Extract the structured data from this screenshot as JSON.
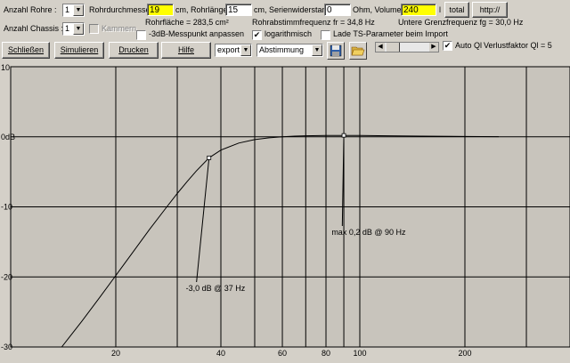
{
  "controls": {
    "anzahl_rohre_label": "Anzahl Rohre :",
    "anzahl_rohre_value": "1",
    "rohrdurchmesser_label": "Rohrdurchmesser",
    "rohrdurchmesser_value": "19",
    "rohrlaenge_label": "cm, Rohrlänge",
    "rohrlaenge_value": "15",
    "serienwiderstand_label": "cm, Serienwiderstand",
    "serienwiderstand_value": "0",
    "volumen_label": "Ohm, Volumen",
    "volumen_value": "240",
    "volumen_unit": "l",
    "total_button": "total",
    "http_button": "http://",
    "anzahl_chassis_label": "Anzahl Chassis :",
    "anzahl_chassis_value": "1",
    "kammern_label": "Kammern",
    "rohrflaeche_text": "Rohrfläche = 283,5 cm²",
    "rohrabstimm_text": "Rohrabstimmfrequenz fr = 34,8 Hz",
    "grenzfrequenz_text": "Untere Grenzfrequenz fg = 30,0 Hz",
    "messpunkt_label": "-3dB-Messpunkt anpassen",
    "logarithmisch_label": "logarithmisch",
    "ts_parameter_label": "Lade TS-Parameter beim Import",
    "schliessen_button": "Schließen",
    "simulieren_button": "Simulieren",
    "drucken_button": "Drucken",
    "hilfe_button": "Hilfe",
    "export_value": "export",
    "abstimmung_value": "Abstimmung",
    "auto_ql_label": "Auto Ql",
    "verlustfaktor_text": "Verlustfaktor Ql = 5"
  },
  "chart_data": {
    "type": "line",
    "x_scale": "log",
    "xlim": [
      10,
      400
    ],
    "ylim": [
      -30,
      10
    ],
    "x_ticks": [
      20,
      40,
      60,
      80,
      100,
      200
    ],
    "y_ticks": [
      10,
      0,
      -10,
      -20,
      -30
    ],
    "x_tick_labels": [
      "20",
      "40",
      "60",
      "80",
      "100",
      "200"
    ],
    "y_tick_labels": [
      "10",
      "0dB",
      "-10",
      "-20",
      "-30"
    ],
    "x_gridlines": [
      20,
      30,
      40,
      50,
      60,
      70,
      80,
      90,
      100,
      200,
      300
    ],
    "grid": true,
    "series": [
      {
        "x": [
          14,
          16,
          18,
          20,
          22,
          25,
          28,
          30,
          32,
          34,
          37,
          40,
          45,
          50,
          55,
          60,
          65,
          70,
          80,
          90,
          100,
          120,
          150,
          200,
          250
        ],
        "y": [
          -30,
          -26.3,
          -22.9,
          -19.8,
          -17.0,
          -13.2,
          -10.0,
          -8.1,
          -6.4,
          -4.9,
          -3.0,
          -1.9,
          -0.9,
          -0.4,
          -0.15,
          0,
          0.1,
          0.15,
          0.2,
          0.2,
          0.18,
          0.15,
          0.1,
          0.05,
          0.02
        ]
      }
    ],
    "annotations": [
      {
        "text": "-3,0 dB @  37 Hz",
        "x": 37,
        "y": -3.0,
        "label_x": 32.5,
        "label_y": -22
      },
      {
        "text": "max 0,2 dB @ 90 Hz",
        "x": 90,
        "y": 0.2,
        "label_x": 85,
        "label_y": -14
      }
    ]
  }
}
